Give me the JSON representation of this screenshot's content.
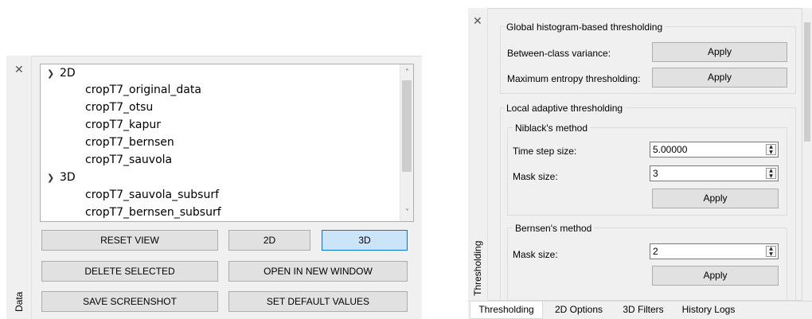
{
  "data_dock": {
    "title": "Data",
    "tree": {
      "groups": [
        {
          "label": "2D",
          "items": [
            "cropT7_original_data",
            "cropT7_otsu",
            "cropT7_kapur",
            "cropT7_bernsen",
            "cropT7_sauvola"
          ]
        },
        {
          "label": "3D",
          "items": [
            "cropT7_sauvola_subsurf",
            "cropT7_bernsen_subsurf"
          ]
        }
      ]
    },
    "buttons": {
      "reset_view": "RESET VIEW",
      "view_2d": "2D",
      "view_3d": "3D",
      "delete_selected": "DELETE SELECTED",
      "open_new_window": "OPEN IN NEW WINDOW",
      "save_screenshot": "SAVE SCREENSHOT",
      "set_default_values": "SET DEFAULT VALUES"
    },
    "active_view": "3D"
  },
  "threshold_dock": {
    "title": "Thresholding",
    "global": {
      "title": "Global histogram-based thresholding",
      "between_class_label": "Between-class variance:",
      "max_entropy_label": "Maximum entropy thresholding:",
      "apply": "Apply"
    },
    "local": {
      "title": "Local adaptive thresholding",
      "niblack": {
        "title": "Niblack's method",
        "time_step_label": "Time step size:",
        "time_step_value": "5.00000",
        "mask_label": "Mask size:",
        "mask_value": "3",
        "apply": "Apply"
      },
      "bernsen": {
        "title": "Bernsen's method",
        "mask_label": "Mask size:",
        "mask_value": "2",
        "apply": "Apply"
      }
    },
    "tabs": [
      "Thresholding",
      "2D Options",
      "3D Filters",
      "History Logs"
    ],
    "active_tab": "Thresholding"
  },
  "colors": {
    "panel_bg": "#f0f0f0",
    "button_bg": "#e1e1e1",
    "active_button_bg": "#cce4f7",
    "active_button_border": "#0078d7"
  }
}
